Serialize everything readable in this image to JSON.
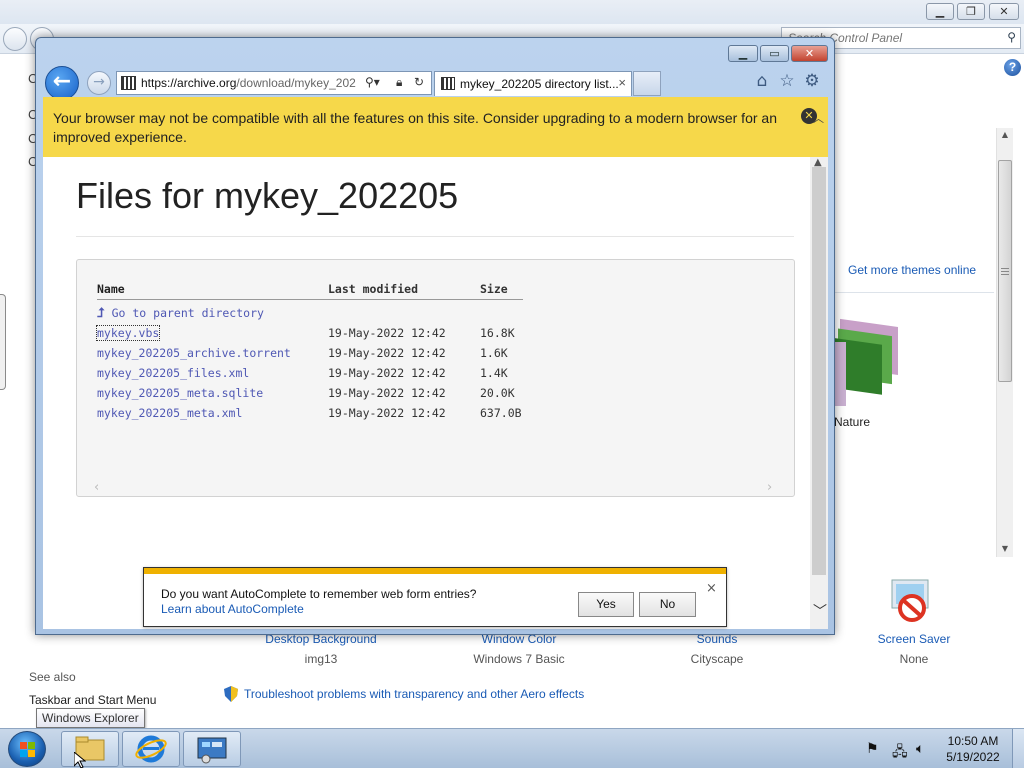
{
  "control_panel": {
    "search_placeholder": "Search Control Panel",
    "help_glyph": "?",
    "left_bullets": [
      "C",
      "C",
      "C",
      "C"
    ],
    "see_also": "See also",
    "taskbar_link": "Taskbar and Start Menu",
    "get_themes": "Get more themes online",
    "nature_label": "Nature",
    "items": [
      {
        "title": "Desktop Background",
        "value": "img13"
      },
      {
        "title": "Window Color",
        "value": "Windows 7 Basic"
      },
      {
        "title": "Sounds",
        "value": "Cityscape"
      },
      {
        "title": "Screen Saver",
        "value": "None"
      }
    ],
    "troubleshoot": "Troubleshoot problems with transparency and other Aero effects"
  },
  "tooltip": "Windows Explorer",
  "ie": {
    "url_host": "https://archive.org",
    "url_path": "/download/mykey_202",
    "tab_title": "mykey_202205 directory list...",
    "tab_close": "×",
    "banner_text": "Your browser may not be compatible with all the features on this site. Consider upgrading to a modern browser for an improved experience.",
    "banner_close": "✕"
  },
  "page": {
    "title": "Files for mykey_202205",
    "columns": [
      "Name",
      "Last modified",
      "Size"
    ],
    "parent_link": "Go to parent directory",
    "files": [
      {
        "name": "mykey.vbs",
        "modified": "19-May-2022 12:42",
        "size": "16.8K"
      },
      {
        "name": "mykey_202205_archive.torrent",
        "modified": "19-May-2022 12:42",
        "size": "1.6K"
      },
      {
        "name": "mykey_202205_files.xml",
        "modified": "19-May-2022 12:42",
        "size": "1.4K"
      },
      {
        "name": "mykey_202205_meta.sqlite",
        "modified": "19-May-2022 12:42",
        "size": "20.0K"
      },
      {
        "name": "mykey_202205_meta.xml",
        "modified": "19-May-2022 12:42",
        "size": "637.0B"
      }
    ]
  },
  "autocomplete": {
    "question": "Do you want AutoComplete to remember web form entries?",
    "learn_link": "Learn about AutoComplete",
    "yes": "Yes",
    "no": "No",
    "close": "×"
  },
  "taskbar": {
    "time": "10:50 AM",
    "date": "5/19/2022"
  },
  "colors": {
    "banner": "#f6d84a",
    "link": "#4f58b4",
    "autocomplete_strip": "#efb100"
  }
}
